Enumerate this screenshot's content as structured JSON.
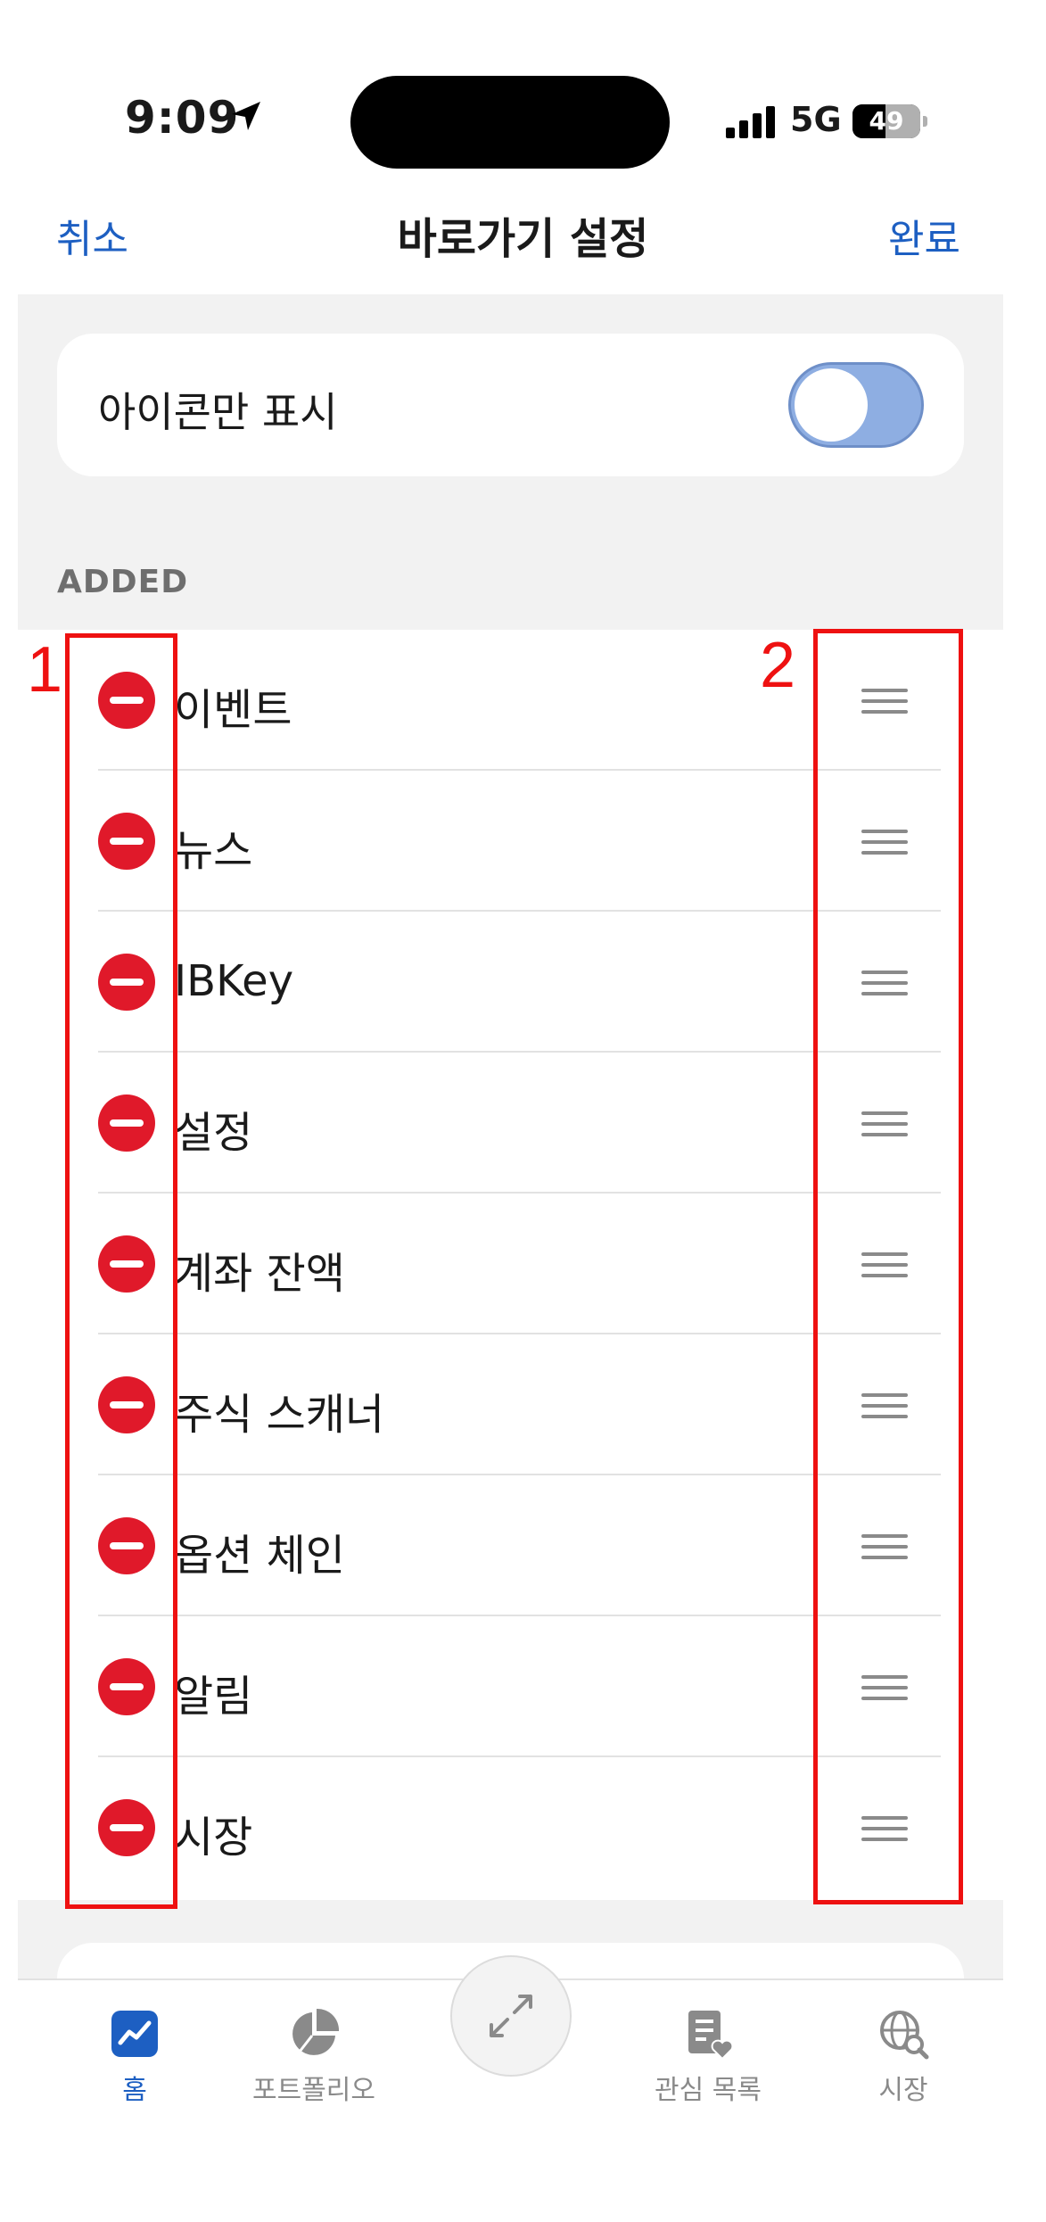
{
  "status_bar": {
    "time": "9:09",
    "network": "5G",
    "battery": "49",
    "battery_level": 0.49
  },
  "nav": {
    "cancel": "취소",
    "title": "바로가기 설정",
    "done": "완료"
  },
  "toggle": {
    "label": "아이콘만 표시",
    "on": true
  },
  "section": {
    "label": "ADDED"
  },
  "items": [
    {
      "label": "이벤트"
    },
    {
      "label": "뉴스"
    },
    {
      "label": "IBKey"
    },
    {
      "label": "설정"
    },
    {
      "label": "계좌 잔액"
    },
    {
      "label": "주식 스캐너"
    },
    {
      "label": "옵션 체인"
    },
    {
      "label": "알림"
    },
    {
      "label": "시장"
    }
  ],
  "annotations": {
    "left_number": "1",
    "right_number": "2",
    "color": "#ee1111"
  },
  "tabbar": {
    "tabs": [
      {
        "label": "홈",
        "icon": "chart-home-icon",
        "active": true
      },
      {
        "label": "포트폴리오",
        "icon": "pie-chart-icon",
        "active": false
      },
      {
        "label": "관심 목록",
        "icon": "watchlist-icon",
        "active": false
      },
      {
        "label": "시장",
        "icon": "globe-search-icon",
        "active": false
      }
    ],
    "center_icon": "expand-arrows-icon"
  },
  "colors": {
    "accent": "#1d5fc2",
    "remove": "#e0192a",
    "toggle_on": "#8eaee2"
  }
}
